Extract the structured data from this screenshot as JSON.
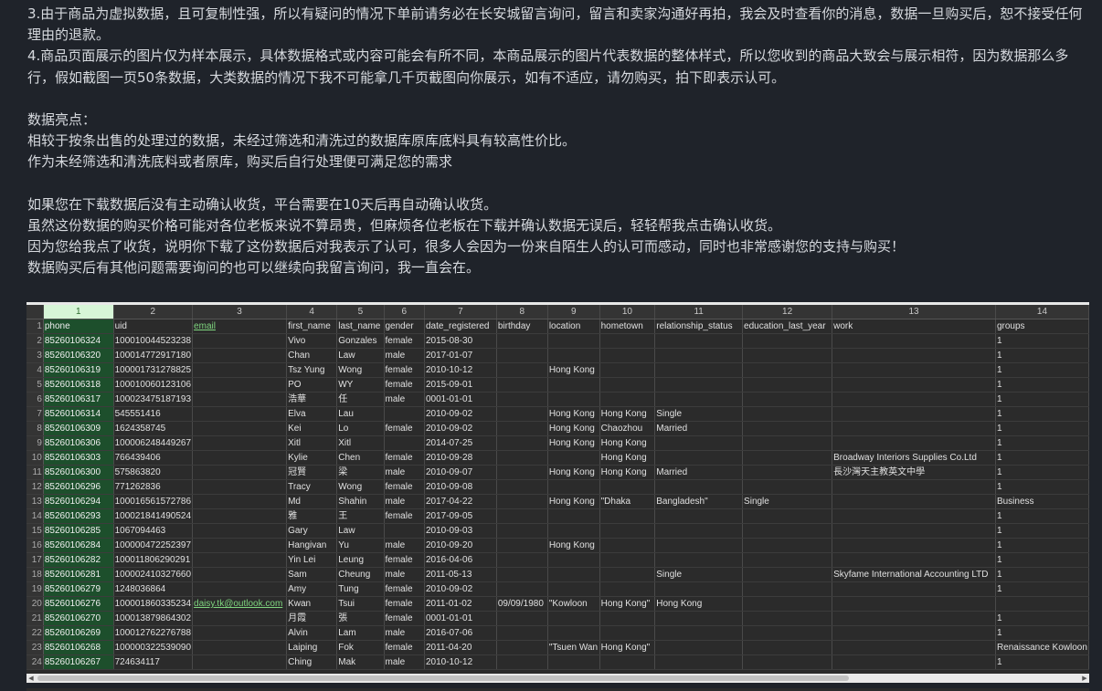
{
  "description": {
    "lines": [
      "3.由于商品为虚拟数据，且可复制性强，所以有疑问的情况下单前请务必在长安城留言询问，留言和卖家沟通好再拍，我会及时查看你的消息，数据一旦购买后，恕不接受任何理由的退款。",
      "4.商品页面展示的图片仅为样本展示，具体数据格式或内容可能会有所不同，本商品展示的图片代表数据的整体样式，所以您收到的商品大致会与展示相符，因为数据那么多行，假如截图一页50条数据，大类数据的情况下我不可能拿几千页截图向你展示，如有不适应，请勿购买，拍下即表示认可。",
      "",
      "数据亮点：",
      "相较于按条出售的处理过的数据，未经过筛选和清洗过的数据库原库底料具有较高性价比。",
      "作为未经筛选和清洗底料或者原库，购买后自行处理便可满足您的需求",
      "",
      "如果您在下载数据后没有主动确认收货，平台需要在10天后再自动确认收货。",
      "虽然这份数据的购买价格可能对各位老板来说不算昂贵，但麻烦各位老板在下载并确认数据无误后，轻轻帮我点击确认收货。",
      "因为您给我点了收货，说明你下载了这份数据后对我表示了认可，很多人会因为一份来自陌生人的认可而感动，同时也非常感谢您的支持与购买！",
      "数据购买后有其他问题需要询问的也可以继续向我留言询问，我一直会在。"
    ]
  },
  "spreadsheet": {
    "col_numbers": [
      "1",
      "2",
      "3",
      "4",
      "5",
      "6",
      "7",
      "8",
      "9",
      "10",
      "11",
      "12",
      "13",
      "14"
    ],
    "rows": [
      [
        "phone",
        "uid",
        "email",
        "first_name",
        "last_name",
        "gender",
        "date_registered",
        "birthday",
        "location",
        "hometown",
        "relationship_status",
        "education_last_year",
        "work",
        "groups"
      ],
      [
        "85260106324",
        "100010044523238",
        "",
        "Vivo",
        "Gonzales",
        "female",
        "2015-08-30",
        "",
        "",
        "",
        "",
        "",
        "",
        "1"
      ],
      [
        "85260106320",
        "100014772917180",
        "",
        "Chan",
        "Law",
        "male",
        "2017-01-07",
        "",
        "",
        "",
        "",
        "",
        "",
        "1"
      ],
      [
        "85260106319",
        "100001731278825",
        "",
        "Tsz Yung",
        "Wong",
        "female",
        "2010-10-12",
        "",
        "Hong Kong",
        "",
        "",
        "",
        "",
        "1"
      ],
      [
        "85260106318",
        "100010060123106",
        "",
        "PO",
        "WY",
        "female",
        "2015-09-01",
        "",
        "",
        "",
        "",
        "",
        "",
        "1"
      ],
      [
        "85260106317",
        "100023475187193",
        "",
        "浩華",
        "任",
        "male",
        "0001-01-01",
        "",
        "",
        "",
        "",
        "",
        "",
        "1"
      ],
      [
        "85260106314",
        "545551416",
        "",
        "Elva",
        "Lau",
        "",
        "2010-09-02",
        "",
        "Hong Kong",
        "Hong Kong",
        "Single",
        "",
        "",
        "1"
      ],
      [
        "85260106309",
        "1624358745",
        "",
        "Kei",
        "Lo",
        "female",
        "2010-09-02",
        "",
        "Hong Kong",
        "Chaozhou",
        "Married",
        "",
        "",
        "1"
      ],
      [
        "85260106306",
        "100006248449267",
        "",
        "Xitl",
        "Xitl",
        "",
        "2014-07-25",
        "",
        "Hong Kong",
        "Hong Kong",
        "",
        "",
        "",
        "1"
      ],
      [
        "85260106303",
        "766439406",
        "",
        "Kylie",
        "Chen",
        "female",
        "2010-09-28",
        "",
        "",
        "Hong Kong",
        "",
        "",
        "Broadway Interiors Supplies Co.Ltd",
        "1"
      ],
      [
        "85260106300",
        "575863820",
        "",
        "冠賢",
        "梁",
        "male",
        "2010-09-07",
        "",
        "Hong Kong",
        "Hong Kong",
        "Married",
        "",
        "長沙灣天主教英文中學",
        "1"
      ],
      [
        "85260106296",
        "771262836",
        "",
        "Tracy",
        "Wong",
        "female",
        "2010-09-08",
        "",
        "",
        "",
        "",
        "",
        "",
        "1"
      ],
      [
        "85260106294",
        "100016561572786",
        "",
        "Md",
        "Shahin",
        "male",
        "2017-04-22",
        "",
        "Hong Kong",
        "\"Dhaka",
        "Bangladesh\"",
        "Single",
        "",
        "Business"
      ],
      [
        "85260106293",
        "100021841490524",
        "",
        "雅",
        "王",
        "female",
        "2017-09-05",
        "",
        "",
        "",
        "",
        "",
        "",
        "1"
      ],
      [
        "85260106285",
        "1067094463",
        "",
        "Gary",
        "Law",
        "",
        "2010-09-03",
        "",
        "",
        "",
        "",
        "",
        "",
        "1"
      ],
      [
        "85260106284",
        "100000472252397",
        "",
        "Hangivan",
        "Yu",
        "male",
        "2010-09-20",
        "",
        "Hong Kong",
        "",
        "",
        "",
        "",
        "1"
      ],
      [
        "85260106282",
        "100011806290291",
        "",
        "Yin Lei",
        "Leung",
        "female",
        "2016-04-06",
        "",
        "",
        "",
        "",
        "",
        "",
        "1"
      ],
      [
        "85260106281",
        "100002410327660",
        "",
        "Sam",
        "Cheung",
        "male",
        "2011-05-13",
        "",
        "",
        "",
        "Single",
        "",
        "Skyfame International Accounting LTD",
        "1"
      ],
      [
        "85260106279",
        "1248036864",
        "",
        "Amy",
        "Tung",
        "female",
        "2010-09-02",
        "",
        "",
        "",
        "",
        "",
        "",
        "1"
      ],
      [
        "85260106276",
        "100001860335234",
        "daisy.tk@outlook.com",
        "Kwan",
        "Tsui",
        "female",
        "2011-01-02",
        "09/09/1980",
        "\"Kowloon",
        "Hong Kong\"",
        "Hong Kong",
        "",
        "",
        ""
      ],
      [
        "85260106270",
        "100013879864302",
        "",
        "月霞",
        "張",
        "female",
        "0001-01-01",
        "",
        "",
        "",
        "",
        "",
        "",
        "1"
      ],
      [
        "85260106269",
        "100012762276788",
        "",
        "Alvin",
        "Lam",
        "male",
        "2016-07-06",
        "",
        "",
        "",
        "",
        "",
        "",
        "1"
      ],
      [
        "85260106268",
        "100000322539090",
        "",
        "Laiping",
        "Fok",
        "female",
        "2011-04-20",
        "",
        "\"Tsuen Wan",
        "Hong Kong\"",
        "",
        "",
        "",
        "Renaissance Kowloon"
      ],
      [
        "85260106267",
        "724634117",
        "",
        "Ching",
        "Mak",
        "male",
        "2010-10-12",
        "",
        "",
        "",
        "",
        "",
        "",
        "1"
      ]
    ]
  }
}
